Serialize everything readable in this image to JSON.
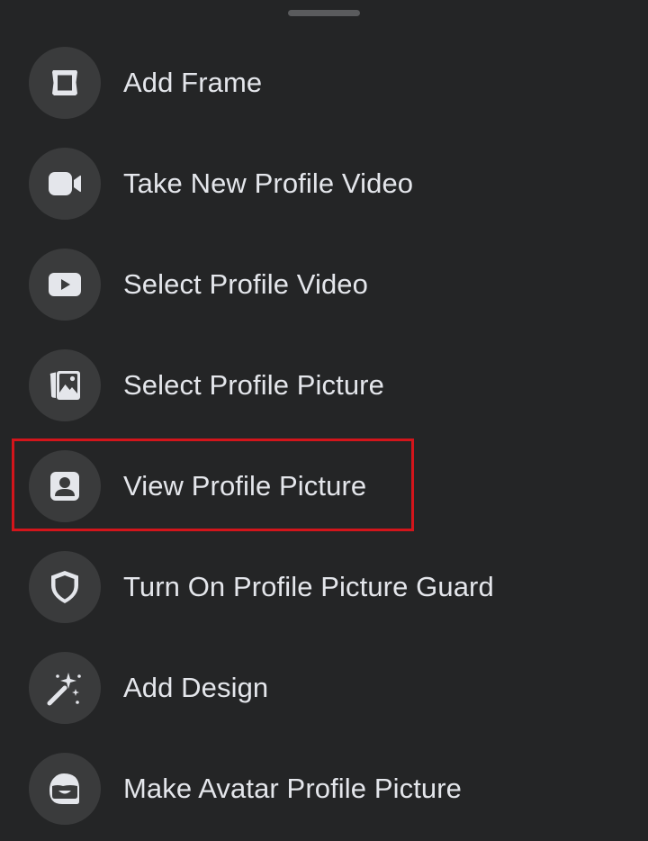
{
  "menu": {
    "items": [
      {
        "label": "Add Frame",
        "icon": "frame-icon"
      },
      {
        "label": "Take New Profile Video",
        "icon": "video-camera-icon"
      },
      {
        "label": "Select Profile Video",
        "icon": "play-video-icon"
      },
      {
        "label": "Select Profile Picture",
        "icon": "photo-gallery-icon"
      },
      {
        "label": "View Profile Picture",
        "icon": "person-portrait-icon",
        "highlighted": true
      },
      {
        "label": "Turn On Profile Picture Guard",
        "icon": "shield-icon"
      },
      {
        "label": "Add Design",
        "icon": "magic-wand-icon"
      },
      {
        "label": "Make Avatar Profile Picture",
        "icon": "avatar-face-icon"
      }
    ]
  },
  "colors": {
    "background": "#242526",
    "icon_circle": "#3a3b3c",
    "text": "#e4e6eb",
    "highlight": "#d3151b"
  }
}
